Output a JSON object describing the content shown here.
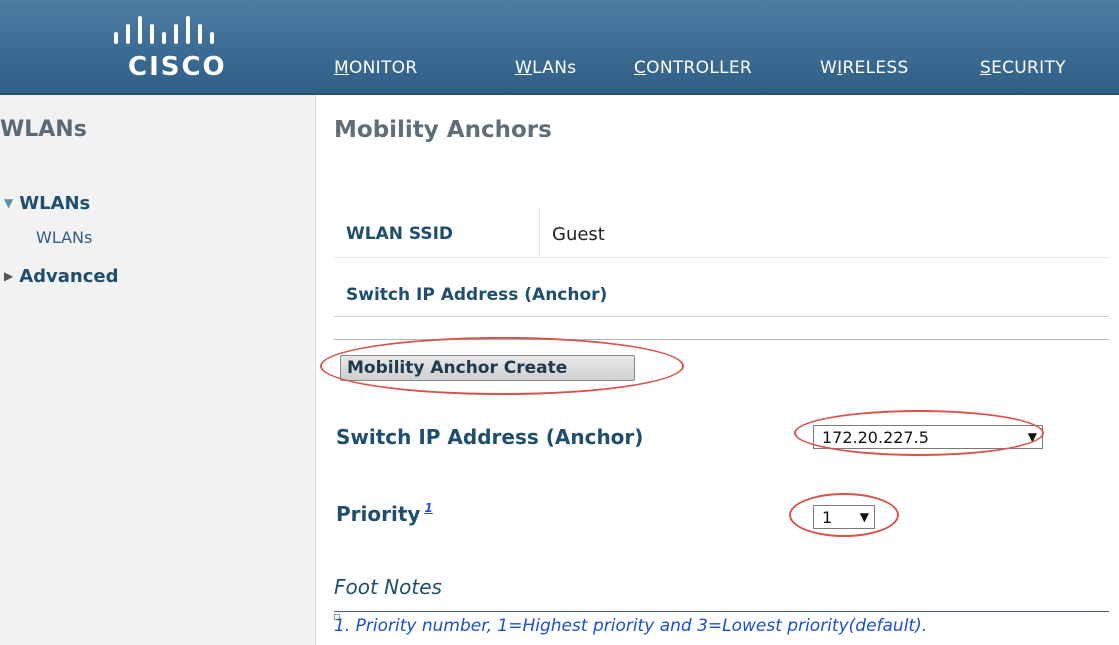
{
  "header": {
    "logo_text": "CISCO",
    "nav": [
      {
        "accesskey": "M",
        "rest": "ONITOR",
        "prefix": ""
      },
      {
        "accesskey": "W",
        "rest": "LANs",
        "prefix": ""
      },
      {
        "accesskey": "C",
        "rest": "ONTROLLER",
        "prefix": ""
      },
      {
        "accesskey": "I",
        "rest": "RELESS",
        "prefix": "W"
      },
      {
        "accesskey": "S",
        "rest": "ECURITY",
        "prefix": ""
      }
    ]
  },
  "sidebar": {
    "title": "WLANs",
    "groups": [
      {
        "label": "WLANs",
        "expanded": true,
        "items": [
          {
            "label": "WLANs"
          }
        ]
      },
      {
        "label": "Advanced",
        "expanded": false
      }
    ]
  },
  "main": {
    "title": "Mobility Anchors",
    "wlan_ssid_label": "WLAN SSID",
    "wlan_ssid_value": "Guest",
    "anchor_column_header": "Switch IP Address (Anchor)",
    "create_button": "Mobility Anchor Create",
    "switch_ip_label": "Switch IP Address (Anchor)",
    "switch_ip_value": "172.20.227.5",
    "priority_label": "Priority",
    "priority_footnote": "1",
    "priority_value": "1",
    "foot_notes_title": "Foot Notes",
    "foot_note_1": "1. Priority number, 1=Highest priority and 3=Lowest priority(default)."
  },
  "colors": {
    "header": "#3f6f95",
    "highlight_ellipse": "#d9534a",
    "label_blue": "#1f4f6e",
    "footnote_blue": "#1a4fd0"
  }
}
